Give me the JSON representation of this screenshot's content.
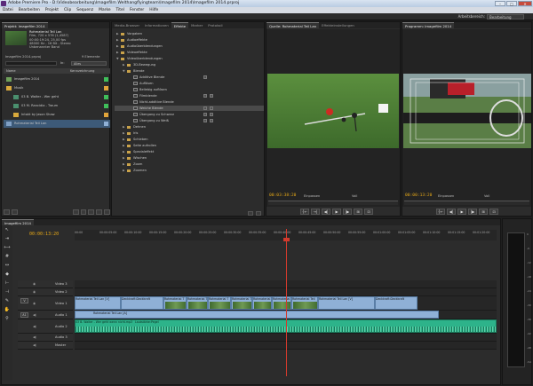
{
  "titlebar": {
    "text": "Adobe Premiere Pro - D:\\Videobearbeitung\\Imagefilm Welthangflyingteam\\Imagefilm 2014\\Imagefilm 2014.prproj"
  },
  "menu": [
    "Datei",
    "Bearbeiten",
    "Projekt",
    "Clip",
    "Sequenz",
    "Marke",
    "Titel",
    "Fenster",
    "Hilfe"
  ],
  "workspace": {
    "label": "Arbeitsbereich:",
    "value": "Bearbeitung"
  },
  "project": {
    "tabs": [
      "Projekt: Imagefilm 2014",
      "Media-Browser",
      "Informationen",
      "Effekte",
      "Marker",
      "Protokoll"
    ],
    "clip_title": "Rohmaterial Teil Lan",
    "clip_info": [
      "Film, 720 x 576 (1,4587)",
      "00:00:19:24, 25,00 fps",
      "48000 Hz - 16 Bit - Stereo",
      "Unbenannter Band"
    ],
    "project_name": "Imagefilm 2014.prproj",
    "item_count": "9 Elemente",
    "find_label": "In:",
    "find_scope": "Alles",
    "columns": [
      "Name",
      "Kennzeichnung"
    ],
    "items": [
      {
        "name": "Imagefilm 2014",
        "indent": 0,
        "kind": "sequence",
        "color": "#3fbf5a",
        "selected": false
      },
      {
        "name": "Musik",
        "indent": 0,
        "kind": "folder",
        "color": "#e1a43a",
        "selected": false
      },
      {
        "name": "03 B. Walter - Wer geht",
        "indent": 1,
        "kind": "audio",
        "color": "#3fbf5a",
        "selected": false
      },
      {
        "name": "03 M. Rancidia - Traum",
        "indent": 1,
        "kind": "audio",
        "color": "#3fbf5a",
        "selected": false
      },
      {
        "name": "Intakt by Jason Shaw",
        "indent": 1,
        "kind": "folder",
        "color": "#e1a43a",
        "selected": false
      },
      {
        "name": "Rohmaterial Teil Lan",
        "indent": 0,
        "kind": "video",
        "color": "#8fb0d6",
        "selected": true
      }
    ]
  },
  "effects": {
    "tabs": [
      "Media-Browser",
      "Informationen",
      "Effekte",
      "Marker",
      "Protokoll"
    ],
    "tree": [
      {
        "label": "Vorgaben",
        "indent": 0,
        "kind": "folder",
        "open": false
      },
      {
        "label": "Audioeffekte",
        "indent": 0,
        "kind": "folder",
        "open": false
      },
      {
        "label": "Audioüberblendungen",
        "indent": 0,
        "kind": "folder",
        "open": false
      },
      {
        "label": "Videoeffekte",
        "indent": 0,
        "kind": "folder",
        "open": false
      },
      {
        "label": "Videoüberblendungen",
        "indent": 0,
        "kind": "folder",
        "open": true
      },
      {
        "label": "3D-Bewegung",
        "indent": 1,
        "kind": "folder",
        "open": false
      },
      {
        "label": "Blende",
        "indent": 1,
        "kind": "folder",
        "open": true
      },
      {
        "label": "Additive Blende",
        "indent": 2,
        "kind": "fx",
        "badges": 1
      },
      {
        "label": "Auflösen",
        "indent": 2,
        "kind": "fx",
        "badges": 0
      },
      {
        "label": "Beliebig auflösen",
        "indent": 2,
        "kind": "fx",
        "badges": 0
      },
      {
        "label": "Filmblende",
        "indent": 2,
        "kind": "fx",
        "badges": 2
      },
      {
        "label": "Nicht-additive Blende",
        "indent": 2,
        "kind": "fx",
        "badges": 0
      },
      {
        "label": "Weiche Blende",
        "indent": 2,
        "kind": "fx",
        "badges": 2,
        "selected": true
      },
      {
        "label": "Übergang zu Schwarz",
        "indent": 2,
        "kind": "fx",
        "badges": 2
      },
      {
        "label": "Übergang zu Weiß",
        "indent": 2,
        "kind": "fx",
        "badges": 2
      },
      {
        "label": "Dehnen",
        "indent": 1,
        "kind": "folder",
        "open": false
      },
      {
        "label": "Iris",
        "indent": 1,
        "kind": "folder",
        "open": false
      },
      {
        "label": "Schieben",
        "indent": 1,
        "kind": "folder",
        "open": false
      },
      {
        "label": "Seite aufrollen",
        "indent": 1,
        "kind": "folder",
        "open": false
      },
      {
        "label": "Spezialeffekt",
        "indent": 1,
        "kind": "folder",
        "open": false
      },
      {
        "label": "Wischen",
        "indent": 1,
        "kind": "folder",
        "open": false
      },
      {
        "label": "Zoom",
        "indent": 1,
        "kind": "folder",
        "open": false
      },
      {
        "label": "Zoomen",
        "indent": 1,
        "kind": "folder",
        "open": false
      }
    ]
  },
  "source": {
    "tabs": [
      "Quelle: Rohmaterial Teil Lan",
      "Effekteinstellungen"
    ],
    "timecode": "00:03:38:20",
    "fit": "Einpassen",
    "quality": "Voll",
    "buttons": [
      "{←",
      "→|",
      "◀|",
      "▶",
      "|▶",
      "⊞",
      "⊡"
    ]
  },
  "program": {
    "tabs": [
      "Programm: Imagefilm 2014"
    ],
    "timecode": "00:00:13:20",
    "fit": "Einpassen",
    "quality": "Voll",
    "buttons": [
      "{←",
      "◀|",
      "▶",
      "|▶",
      "⊞",
      "⊡"
    ]
  },
  "timeline": {
    "tab": "Imagefilm 2014",
    "timecode": "00:00:13:20",
    "ticks": [
      "00:00",
      "00:00:05:00",
      "00:00:10:00",
      "00:00:15:00",
      "00:00:20:00",
      "00:00:25:00",
      "00:00:30:00",
      "00:00:35:00",
      "00:00:40:00",
      "00:00:45:00",
      "00:00:50:00",
      "00:00:55:00",
      "00:01:00:00",
      "00:01:05:00",
      "00:01:10:00",
      "00:01:15:00",
      "00:01:20:00"
    ],
    "tracks": [
      {
        "id": "v3",
        "name": "Video 3",
        "type": "video"
      },
      {
        "id": "v2",
        "name": "Video 2",
        "type": "video"
      },
      {
        "id": "v1",
        "name": "Video 1",
        "type": "video",
        "badge": "V"
      },
      {
        "id": "a1",
        "name": "Audio 1",
        "type": "audio",
        "badge": "A1"
      },
      {
        "id": "a2",
        "name": "Audio 2",
        "type": "audio"
      },
      {
        "id": "a3",
        "name": "Audio 3",
        "type": "audio"
      },
      {
        "id": "master",
        "name": "Master",
        "type": "audio"
      }
    ],
    "v1_clips": [
      "Rohmaterial Teil Lan [V]",
      "Deckkraft:Deckkraft",
      "Rohmaterial T",
      "Rohmaterial T",
      "Rohmaterial T",
      "Rohmaterial T",
      "Rohmaterial",
      "Rohmaterial",
      "Rohmaterial Teil",
      "Rohmaterial Teil Lan [V]",
      "Deckkraft:Deckkraft"
    ],
    "a1_clip": "Rohmaterial Teil Lan [A]",
    "a2_clip": "03 B. Walter - Wer geht wenn nicht.mp3",
    "a2_effect": "Lautstärke:Pegel"
  },
  "meter": {
    "scale": [
      "0",
      "-6",
      "-12",
      "-18",
      "-24",
      "-30",
      "-36",
      "-42",
      "-48",
      "-54"
    ]
  }
}
